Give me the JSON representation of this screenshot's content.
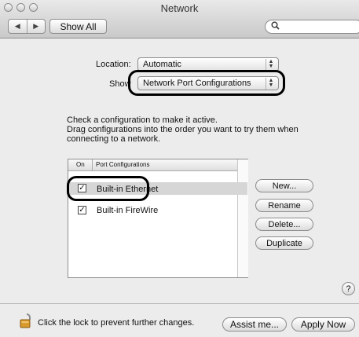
{
  "window": {
    "title": "Network"
  },
  "toolbar": {
    "back_glyph": "◀",
    "forward_glyph": "▶",
    "show_all_label": "Show All",
    "search_placeholder": "",
    "search_icon": "magnifier-icon"
  },
  "location": {
    "label": "Location:",
    "value": "Automatic"
  },
  "show": {
    "label": "Show",
    "value": "Network Port Configurations"
  },
  "instructions": {
    "line1": "Check a configuration to make it active.",
    "line2": "Drag configurations into the order you want to try them when",
    "line3": "connecting to a network."
  },
  "port_list": {
    "headers": {
      "on": "On",
      "configs": "Port Configurations"
    },
    "rows": [
      {
        "name": "Built-in Ethernet",
        "checked": true,
        "selected": true
      },
      {
        "name": "Built-in FireWire",
        "checked": true,
        "selected": false
      }
    ]
  },
  "list_buttons": {
    "new": "New...",
    "rename": "Rename",
    "delete": "Delete...",
    "duplicate": "Duplicate"
  },
  "help": {
    "glyph": "?"
  },
  "footer": {
    "lock_text": "Click the lock to prevent further changes.",
    "assist_label": "Assist me...",
    "apply_label": "Apply Now"
  },
  "colors": {
    "highlight_outline": "#000000",
    "window_bg": "#ececec",
    "selection": "#d6d6d6"
  }
}
